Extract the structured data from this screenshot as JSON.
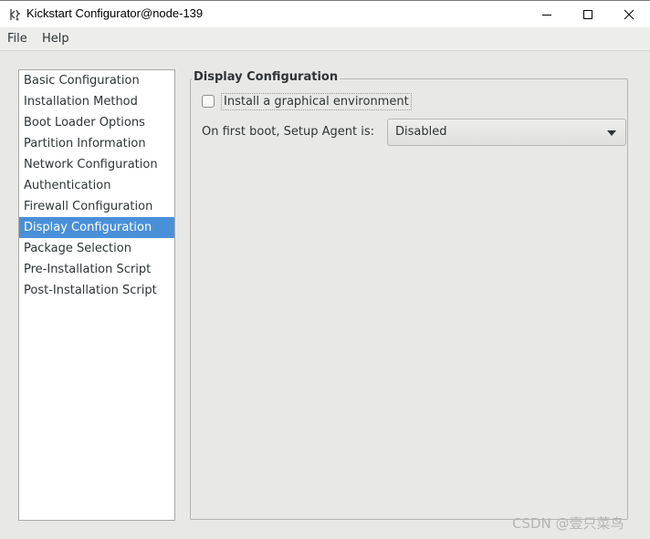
{
  "window": {
    "title": "Kickstart Configurator@node-139",
    "icon": "kickstart-app-icon",
    "controls": [
      "minimize-icon",
      "maximize-icon",
      "close-icon"
    ]
  },
  "menu": {
    "file": "File",
    "help": "Help"
  },
  "sidebar": {
    "items": [
      {
        "label": "Basic Configuration"
      },
      {
        "label": "Installation Method"
      },
      {
        "label": "Boot Loader Options"
      },
      {
        "label": "Partition Information"
      },
      {
        "label": "Network Configuration"
      },
      {
        "label": "Authentication"
      },
      {
        "label": "Firewall Configuration"
      },
      {
        "label": "Display Configuration",
        "selected": true
      },
      {
        "label": "Package Selection"
      },
      {
        "label": "Pre-Installation Script"
      },
      {
        "label": "Post-Installation Script"
      }
    ]
  },
  "display_config": {
    "title": "Display Configuration",
    "graphical_env_label": "Install a graphical environment",
    "graphical_env_checked": false,
    "setup_agent_label": "On first boot, Setup Agent is:",
    "setup_agent_value": "Disabled"
  },
  "watermark": "CSDN @壹只菜鸟",
  "colors": {
    "selection": "#4a90d9",
    "background": "#e8e8e7"
  }
}
